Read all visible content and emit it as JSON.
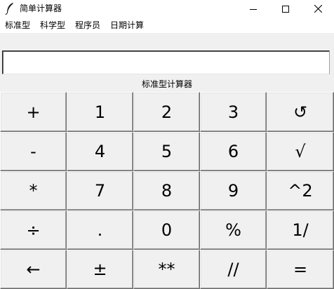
{
  "window": {
    "title": "简单计算器",
    "app_icon": "feather-icon",
    "controls": [
      "minimize-icon",
      "maximize-icon",
      "close-icon"
    ]
  },
  "menu": {
    "items": [
      "标准型",
      "科学型",
      "程序员",
      "日期计算"
    ]
  },
  "display": {
    "value": ""
  },
  "mode_label": "标准型计算器",
  "keypad": {
    "rows": [
      [
        "+",
        "1",
        "2",
        "3",
        "↺"
      ],
      [
        "-",
        "4",
        "5",
        "6",
        "√"
      ],
      [
        "*",
        "7",
        "8",
        "9",
        "^2"
      ],
      [
        "÷",
        ".",
        "0",
        "%",
        "1/"
      ],
      [
        "←",
        "±",
        "**",
        "//",
        "="
      ]
    ]
  }
}
